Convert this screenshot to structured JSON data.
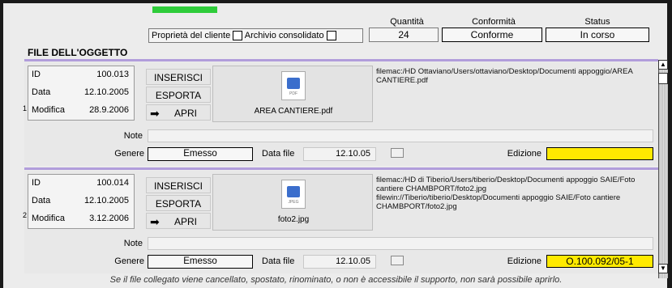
{
  "header": {
    "quantita_label": "Quantità",
    "quantita_value": "24",
    "conformita_label": "Conformità",
    "conformita_value": "Conforme",
    "status_label": "Status",
    "status_value": "In corso",
    "proprieta_label": "Proprietà del cliente",
    "archivio_label": "Archivio consolidato"
  },
  "section_title": "FILE DELL'OGGETTO",
  "records": [
    {
      "index": "1",
      "id_label": "ID",
      "id_value": "100.013",
      "data_label": "Data",
      "data_value": "12.10.2005",
      "modifica_label": "Modifica",
      "modifica_value": "28.9.2006",
      "btn_inserisci": "INSERISCI",
      "btn_esporta": "ESPORTA",
      "btn_apri": "APRI",
      "file_type": "PDF",
      "file_name": "AREA CANTIERE.pdf",
      "paths": "filemac:/HD Ottaviano/Users/ottaviano/Desktop/Documenti appoggio/AREA CANTIERE.pdf",
      "note_label": "Note",
      "note_value": "",
      "genere_label": "Genere",
      "genere_value": "Emesso",
      "datafile_label": "Data file",
      "datafile_value": "12.10.05",
      "edizione_label": "Edizione",
      "edizione_value": ""
    },
    {
      "index": "2",
      "id_label": "ID",
      "id_value": "100.014",
      "data_label": "Data",
      "data_value": "12.10.2005",
      "modifica_label": "Modifica",
      "modifica_value": "3.12.2006",
      "btn_inserisci": "INSERISCI",
      "btn_esporta": "ESPORTA",
      "btn_apri": "APRI",
      "file_type": "JPEG",
      "file_name": "foto2.jpg",
      "paths": "filemac:/HD di Tiberio/Users/tiberio/Desktop/Documenti appoggio SAIE/Foto cantiere CHAMBPORT/foto2.jpg\nfilewin://Tiberio/tiberio/Desktop/Documenti appoggio SAIE/Foto cantiere CHAMBPORT/foto2.jpg",
      "note_label": "Note",
      "note_value": "",
      "genere_label": "Genere",
      "genere_value": "Emesso",
      "datafile_label": "Data file",
      "datafile_value": "12.10.05",
      "edizione_label": "Edizione",
      "edizione_value": "O.100.092/05-1"
    }
  ],
  "footer_note": "Se il file collegato viene cancellato, spostato, rinominato, o non è accessibile il supporto, non sarà possibile aprirlo.",
  "colors": {
    "accent_purple": "#b19ddb",
    "highlight_yellow": "#ffea00",
    "green_bar": "#2ecc3a"
  },
  "icons": {
    "apri": "arrow-right-icon",
    "calendar": "calendar-icon",
    "scroll_up": "scroll-up-icon",
    "scroll_down": "scroll-down-icon"
  }
}
